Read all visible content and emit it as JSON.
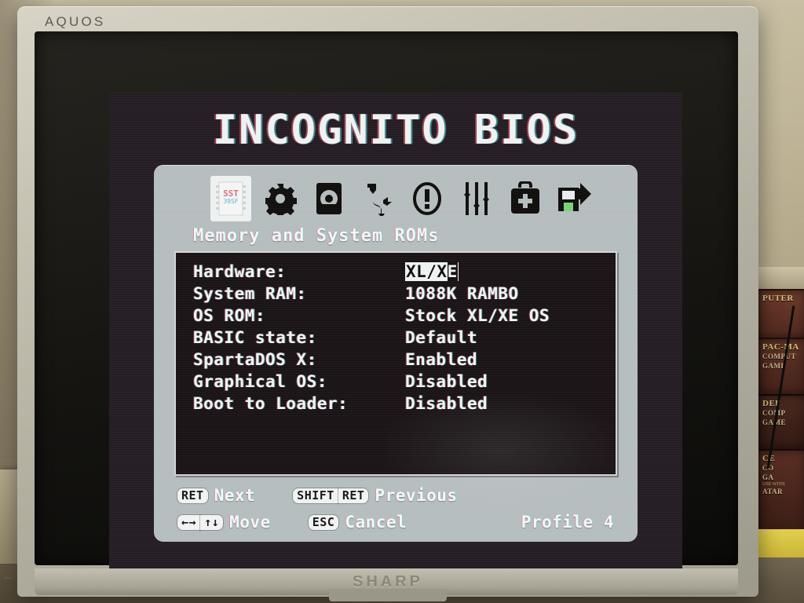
{
  "monitor": {
    "brand_top": "AQUOS",
    "brand_bottom": "SHARP"
  },
  "shelf": {
    "boxes": [
      {
        "line1": "PUTER",
        "line2": "",
        "line3": ""
      },
      {
        "line1": "PAC-MA",
        "line2": "COMPUT",
        "line3": "GAME"
      },
      {
        "line1": "DEF",
        "line2": "COMP",
        "line3": "GAME"
      },
      {
        "line1": "CE",
        "line2": "CO",
        "line3": "GA",
        "line4": "USE WITH",
        "line5": "ATAR"
      }
    ]
  },
  "bios": {
    "title": "INCOGNITO BIOS",
    "iconbar": [
      {
        "name": "memory-chip-icon",
        "label": "SST",
        "selected": true
      },
      {
        "name": "gear-icon",
        "label": "Settings",
        "selected": false
      },
      {
        "name": "disk-drive-icon",
        "label": "Drives",
        "selected": false
      },
      {
        "name": "cable-connector-icon",
        "label": "Connections",
        "selected": false
      },
      {
        "name": "warning-icon",
        "label": "Warnings",
        "selected": false
      },
      {
        "name": "sliders-icon",
        "label": "Tuning",
        "selected": false
      },
      {
        "name": "first-aid-bag-icon",
        "label": "Diagnostics",
        "selected": false
      },
      {
        "name": "save-exit-icon",
        "label": "Save and Exit",
        "selected": false
      }
    ],
    "section_title": "Memory and System ROMs",
    "settings": [
      {
        "label": "Hardware:",
        "value": "XL/XE",
        "highlighted": true,
        "cursor": "E"
      },
      {
        "label": "System RAM:",
        "value": "1088K RAMBO",
        "highlighted": false
      },
      {
        "label": "OS ROM:",
        "value": "Stock XL/XE OS",
        "highlighted": false
      },
      {
        "label": "BASIC state:",
        "value": "Default",
        "highlighted": false
      },
      {
        "label": "SpartaDOS X:",
        "value": "Enabled",
        "highlighted": false
      },
      {
        "label": "Graphical OS:",
        "value": "Disabled",
        "highlighted": false
      },
      {
        "label": "Boot to Loader:",
        "value": "Disabled",
        "highlighted": false
      }
    ],
    "footer": {
      "key_ret": "RET",
      "label_next": "Next",
      "key_shift": "SHIFT",
      "key_ret2": "RET",
      "label_previous": "Previous",
      "key_leftright": "←→",
      "key_updown": "↑↓",
      "label_move": "Move",
      "key_esc": "ESC",
      "label_cancel": "Cancel",
      "profile": "Profile 4"
    }
  },
  "colors": {
    "panel": "#b6bdbf",
    "screen_bg": "#241d23",
    "text": "#eef4f2",
    "highlight_bg": "#eef3f1"
  }
}
